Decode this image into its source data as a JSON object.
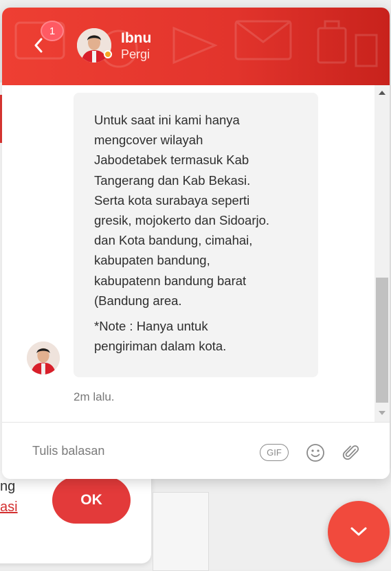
{
  "background_page": {
    "text_fragment": "ng",
    "link_fragment": "asi",
    "ok_button_label": "OK"
  },
  "chat": {
    "header": {
      "unread_count": "1",
      "agent_name": "Ibnu",
      "agent_status": "Pergi",
      "status_color": "#f5a623",
      "header_color": "#e2342c"
    },
    "messages": [
      {
        "text": "Untuk saat ini kami hanya\nmengcover wilayah\nJabodetabek termasuk Kab\nTangerang dan Kab Bekasi.\nSerta kota surabaya seperti\ngresik, mojokerto dan Sidoarjo.\ndan Kota bandung, cimahai,\nkabupaten bandung,\nkabupatenn bandung barat\n(Bandung area.",
        "note": "*Note : Hanya untuk\npengiriman dalam kota.",
        "time": "2m lalu."
      }
    ],
    "composer": {
      "placeholder": "Tulis balasan",
      "gif_label": "GIF",
      "emoji_icon": "smiley-icon",
      "attach_icon": "paperclip-icon"
    },
    "fab_icon": "chevron-down-icon",
    "accent_color": "#f14a3d"
  }
}
